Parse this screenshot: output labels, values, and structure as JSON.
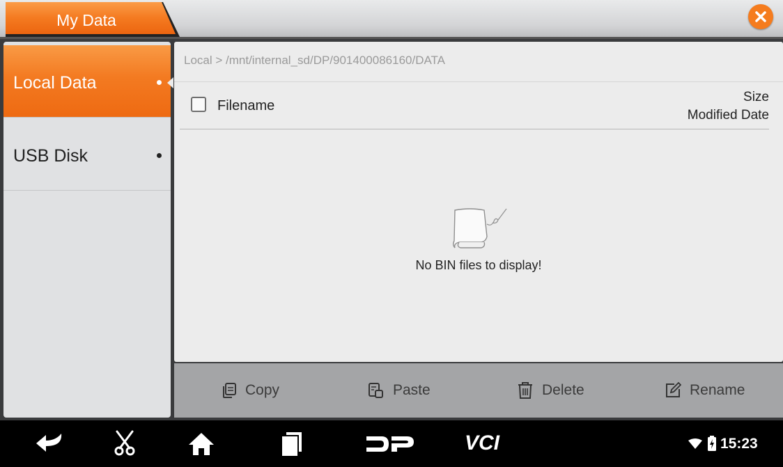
{
  "window": {
    "title": "My Data"
  },
  "sidebar": {
    "items": [
      {
        "label": "Local Data",
        "active": true
      },
      {
        "label": "USB Disk",
        "active": false
      }
    ]
  },
  "main": {
    "breadcrumb": "Local > /mnt/internal_sd/DP/901400086160/DATA",
    "columns": {
      "filename": "Filename",
      "size": "Size",
      "modified": "Modified Date"
    },
    "empty_message": "No BIN files to display!"
  },
  "toolbar": {
    "copy": "Copy",
    "paste": "Paste",
    "delete": "Delete",
    "rename": "Rename"
  },
  "navbar": {
    "icons": [
      "back-icon",
      "scissors-icon",
      "home-icon",
      "recent-apps-icon",
      "dp-logo",
      "vci-logo"
    ],
    "dp_logo_text": "DP",
    "vci_logo_text": "VCI",
    "time": "15:23"
  },
  "colors": {
    "accent": "#F37A21",
    "close": "#F57C1E",
    "panel": "#ECECEC",
    "sidebar": "#E0E1E3",
    "toolbar": "#A4A5A7"
  }
}
